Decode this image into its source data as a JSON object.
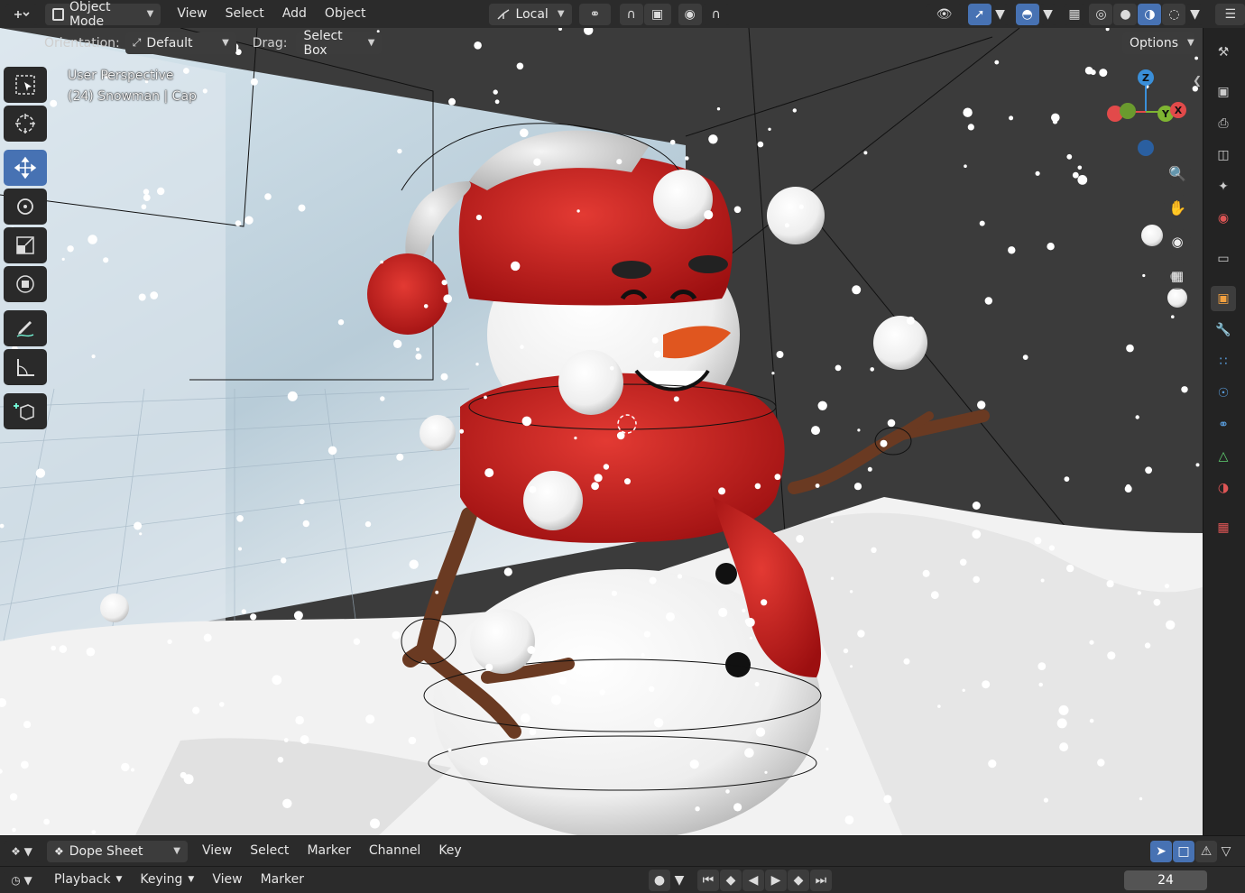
{
  "header": {
    "mode": "Object Mode",
    "menus": [
      "View",
      "Select",
      "Add",
      "Object"
    ],
    "transform_space": "Local"
  },
  "tool_settings": {
    "orientation_label": "Orientation:",
    "orientation_value": "Default",
    "drag_label": "Drag:",
    "drag_value": "Select Box",
    "options": "Options"
  },
  "viewport": {
    "perspective_label": "User Perspective",
    "object_label": "(24) Snowman | Cap"
  },
  "dopesheet": {
    "editor": "Dope Sheet",
    "menus": [
      "View",
      "Select",
      "Marker",
      "Channel",
      "Key"
    ]
  },
  "timeline": {
    "playback": "Playback",
    "keying": "Keying",
    "menus": [
      "View",
      "Marker"
    ],
    "current_frame": "24"
  },
  "colors": {
    "accent": "#4772b3",
    "header_bg": "#2b2b2b",
    "axis_x": "#e24a4a",
    "axis_y": "#7fb532",
    "axis_z": "#3a8fd9"
  }
}
